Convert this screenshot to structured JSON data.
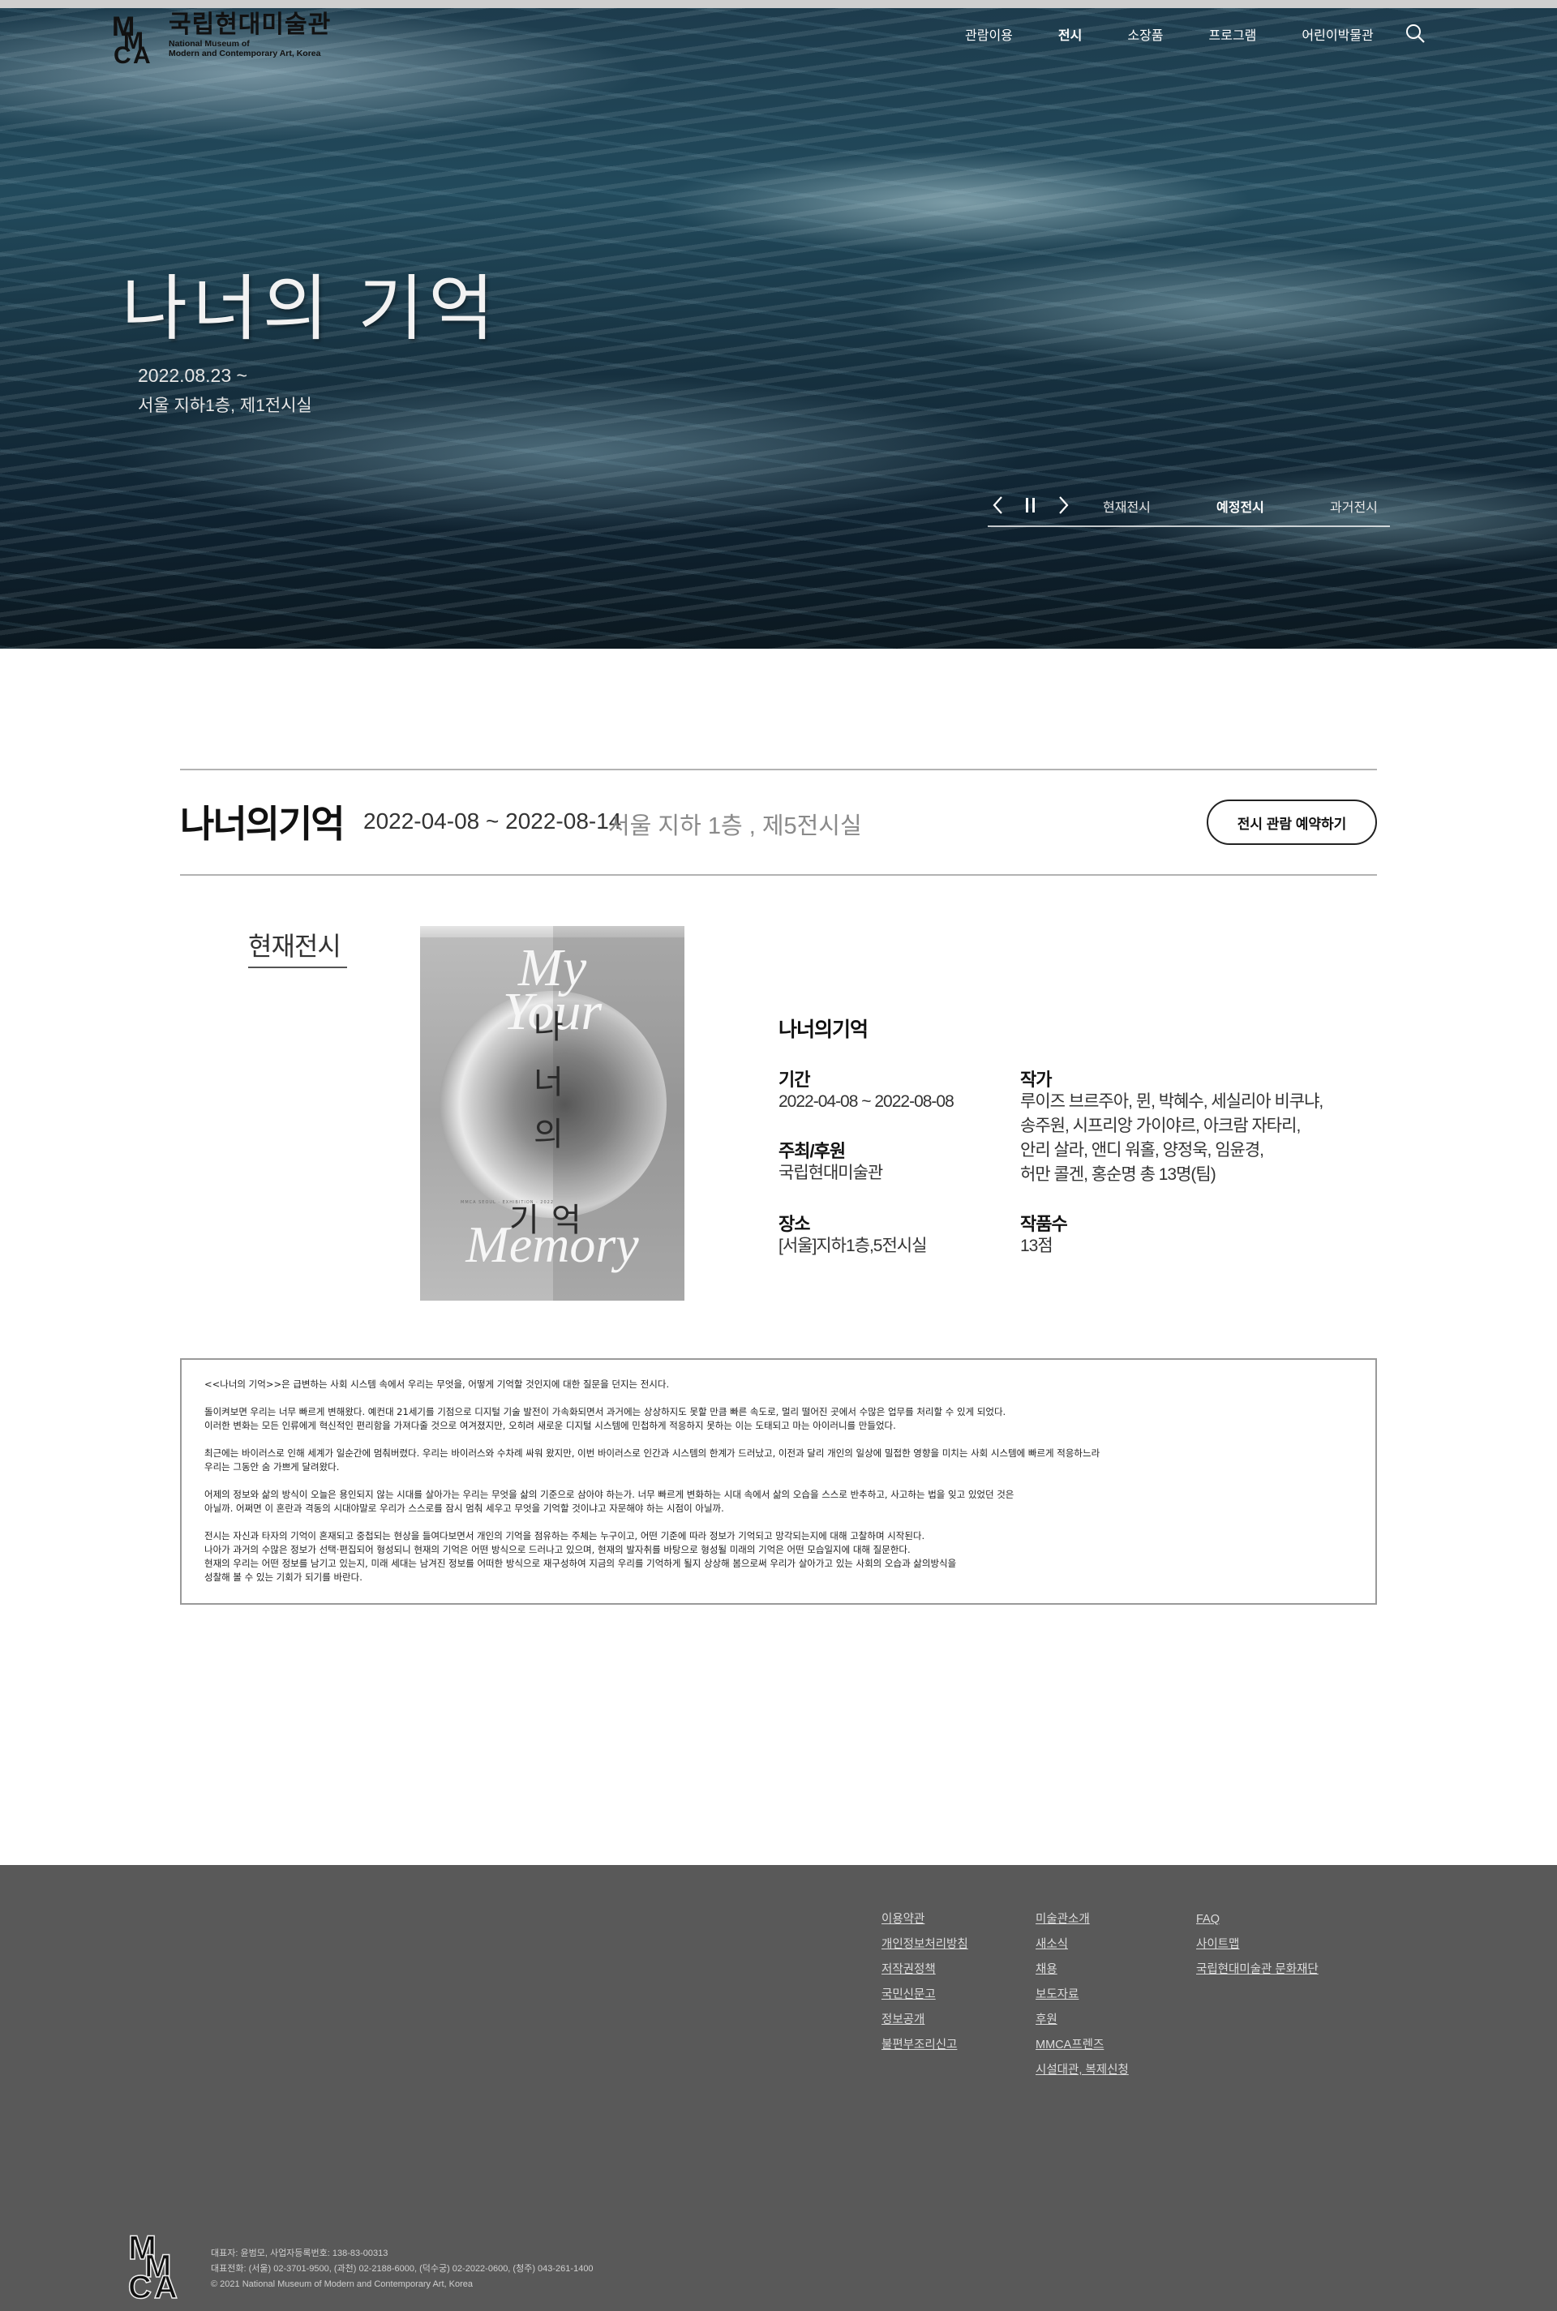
{
  "header": {
    "logo_ko": "국립현대미술관",
    "logo_en_line1": "National Museum of",
    "logo_en_line2": "Modern and Contemporary Art, Korea",
    "nav": [
      "관람이용",
      "전시",
      "소장품",
      "프로그램",
      "어린이박물관"
    ],
    "active_nav_index": 1
  },
  "hero": {
    "title": "나너의 기억",
    "date": "2022.08.23 ~",
    "place": "서울 지하1층, 제1전시실",
    "tabs": [
      "현재전시",
      "예정전시",
      "과거전시"
    ],
    "active_tab_index": 1
  },
  "exhibition": {
    "title": "나너의기억",
    "date": "2022-04-08 ~ 2022-08-14",
    "place": "서울 지하 1층 , 제5전시실",
    "reserve_label": "전시 관람 예약하기",
    "section_label": "현재전시"
  },
  "poster": {
    "line1": "My",
    "line2": "Your",
    "line3": "Memory",
    "vertical_ko": [
      "나",
      "너",
      "의",
      "기",
      "억"
    ],
    "tiny_text": "MMCA SEOUL · EXHIBITION · 2022"
  },
  "info": {
    "name": "나너의기억",
    "period_label": "기간",
    "period": "2022-04-08 ~ 2022-08-08",
    "host_label": "주최/후원",
    "host": "국립현대미술관",
    "venue_label": "장소",
    "venue": "[서울]지하1층,5전시실",
    "artist_label": "작가",
    "artists": [
      "루이즈 브르주아, 뮌, 박혜수, 세실리아 비쿠냐,",
      "송주원, 시프리앙 가이야르, 아크람 자타리,",
      "안리 살라, 앤디 워홀, 양정욱, 임윤경,",
      "허만 콜겐, 홍순명 총 13명(팀)"
    ],
    "count_label": "작품수",
    "count": "13점"
  },
  "description": [
    "<<나너의 기억>>은 급변하는 사회 시스템 속에서 우리는 무엇을, 어떻게 기억할 것인지에 대한 질문을 던지는 전시다.",
    "돌이켜보면 우리는 너무 빠르게 변해왔다. 예컨대 21세기를 기점으로 디지털 기술 발전이 가속화되면서 과거에는 상상하지도 못할 만큼 빠른 속도로, 멀리 떨어진 곳에서 수많은 업무를 처리할 수 있게 되었다.\n이러한 변화는 모든 인류에게 혁신적인 편리함을 가져다줄 것으로 여겨졌지만, 오히려 새로운 디지털 시스템에 민첩하게 적응하지 못하는 이는 도태되고 마는 아이러니를 만들었다.",
    "최근에는 바이러스로 인해 세계가 일순간에 멈춰버렸다. 우리는 바이러스와 수차례 싸워 왔지만, 이번 바이러스로 인간과 시스템의 한계가 드러났고, 이전과 달리 개인의 일상에 밀접한 영향을 미치는 사회 시스템에 빠르게 적응하느라\n우리는 그동안 숨 가쁘게 달려왔다.",
    "어제의 정보와 삶의 방식이 오늘은 용인되지 않는 시대를 살아가는 우리는 무엇을 삶의 기준으로 삼아야 하는가. 너무 빠르게 변화하는 시대 속에서 삶의 오습을 스스로 반추하고, 사고하는 법을 잊고 있었던 것은\n아닐까. 어쩌면 이 혼란과 격동의 시대야말로 우리가 스스로를 잠시 멈춰 세우고 무엇을 기억할 것이냐고 자문해야 하는 시점이 아닐까.",
    "전시는 자신과 타자의 기억이 혼재되고 중첩되는 현상을 들여다보면서 개인의 기억을 점유하는 주체는 누구이고, 어떤 기준에 따라 정보가 기억되고 망각되는지에 대해 고찰하며 시작된다.\n나아가 과거의 수많은 정보가 선택·편집되어 형성되니 현재의 기억은 어떤 방식으로 드러나고 있으며, 현재의 발자취를 바탕으로 형성될 미래의 기억은 어떤 모습일지에 대해 질문한다.\n현재의 우리는 어떤 정보를 남기고 있는지, 미래 세대는 남겨진 정보를 어떠한 방식으로 재구성하여 지금의 우리를 기억하게 될지 상상해 봄으로써 우리가 살아가고 있는 사회의 오습과 삶의방식을\n성찰해 볼 수 있는 기회가 되기를 바란다."
  ],
  "footer": {
    "col1": [
      "이용약관",
      "개인정보처리방침",
      "저작권정책",
      "국민신문고",
      "정보공개",
      "불편부조리신고"
    ],
    "col2": [
      "미술관소개",
      "새소식",
      "채용",
      "보도자료",
      "후원",
      "MMCA프렌즈",
      "시설대관, 복제신청"
    ],
    "col3": [
      "FAQ",
      "사이트맵",
      "국립현대미술관 문화재단"
    ],
    "info_line1": "대표자: 윤범모, 사업자등록번호: 138-83-00313",
    "info_line2": "대표전화: (서울) 02-3701-9500, (과천) 02-2188-6000, (덕수궁) 02-2022-0600, (청주) 043-261-1400",
    "info_line3": "© 2021 National Museum of Modern and Contemporary Art, Korea"
  },
  "colors": {
    "footer_bg": "#595959",
    "rule": "#b3b3b3",
    "text": "#111111"
  }
}
